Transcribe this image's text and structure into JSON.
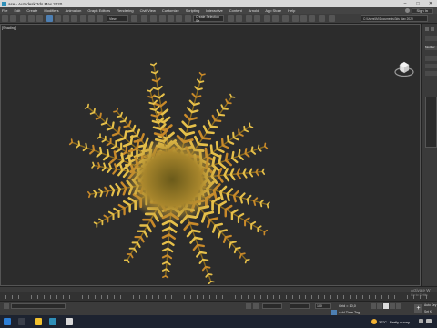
{
  "window": {
    "title": "ase - Autodesk 3ds Max 2020"
  },
  "menu": {
    "items": [
      "File",
      "Edit",
      "Create",
      "Modifiers",
      "Animation",
      "Graph Editors",
      "Rendering",
      "Civil View",
      "Customize",
      "Scripting",
      "Interactive",
      "Content",
      "Arnold",
      "App Store",
      "Help"
    ],
    "signin": "Sign In",
    "workspace": "Workspaces: Default"
  },
  "toolbar": {
    "view_dropdown": "View",
    "selection_set": "Create Selection Se",
    "path": "C:\\Users\\IM\\Documents\\3ds Max 2020"
  },
  "viewport": {
    "label": "[Shading]"
  },
  "command_panel": {
    "modifier_list": "Modifier"
  },
  "watermark": {
    "line1": "Activate W",
    "line2": "Go to Settin"
  },
  "status": {
    "zoom": "100",
    "grid": "Grid = 10,0",
    "add_time_tag": "Add Time Tag",
    "auto_key": "Auto Key",
    "set_key": "Set K",
    "selected": "Selected"
  },
  "taskbar": {
    "temperature": "32°C",
    "weather": "Partly sunny"
  },
  "colors": {
    "accent": "#4d7fb3",
    "viewport_bg": "#2c2c2c",
    "fern_yellow": "#e6c04a",
    "fern_orange": "#c98a2a"
  }
}
